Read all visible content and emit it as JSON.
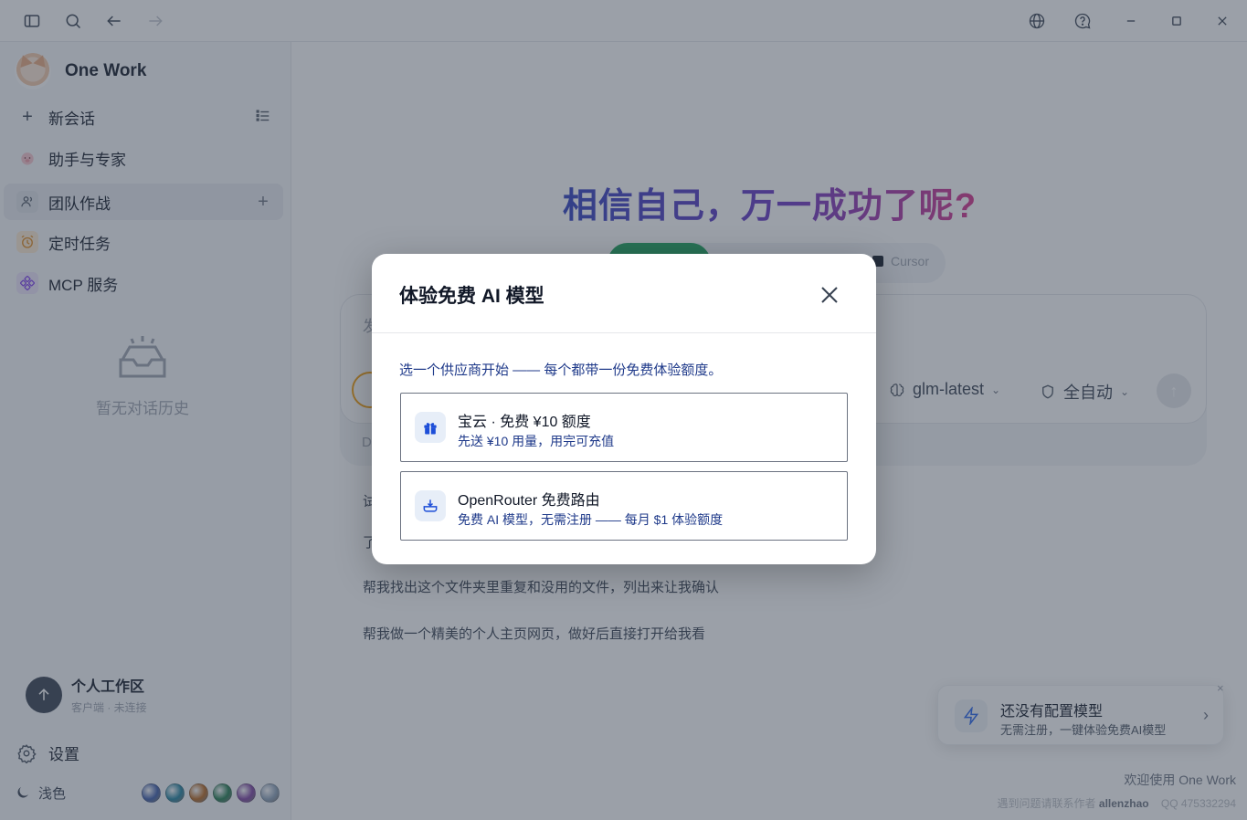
{
  "sidebar": {
    "brand": "One Work",
    "items": [
      {
        "label": "新会话"
      },
      {
        "label": "助手与专家"
      },
      {
        "label": "团队作战"
      },
      {
        "label": "定时任务"
      },
      {
        "label": "MCP 服务"
      }
    ],
    "empty_history": "暂无对话历史",
    "workspace": {
      "title": "个人工作区",
      "status": "客户端 · 未连接"
    },
    "settings_label": "设置",
    "theme_label": "浅色",
    "swatch_colors": [
      "#3b5ba9",
      "#1e7f9c",
      "#b5651d",
      "#1f7a4d",
      "#7b3fa0",
      "#8aa0b8"
    ]
  },
  "main": {
    "headline": "相信自己，万一成功了呢?",
    "pill_cursor": "Cursor",
    "composer_placeholder": "发",
    "model": "glm-latest",
    "mode": "全自动",
    "composer_bottom": "D",
    "suggestions": [
      "试",
      "了",
      "帮我找出这个文件夹里重复和没用的文件，列出来让我确认",
      "帮我做一个精美的个人主页网页，做好后直接打开给我看"
    ]
  },
  "toast": {
    "title": "还没有配置模型",
    "subtitle": "无需注册，一键体验免费AI模型"
  },
  "footer": {
    "welcome": "欢迎使用 One Work",
    "contact_prefix": "遇到问题请联系作者",
    "author": "allenzhao",
    "qq": "QQ 475332294"
  },
  "dialog": {
    "title": "体验免费 AI 模型",
    "description": "选一个供应商开始 —— 每个都带一份免费体验额度。",
    "options": [
      {
        "title": "宝云 · 免费 ¥10 额度",
        "subtitle": "先送 ¥10 用量，用完可充值",
        "icon": "gift-icon"
      },
      {
        "title": "OpenRouter 免费路由",
        "subtitle": "免费 AI 模型，无需注册 —— 每月 $1 体验额度",
        "icon": "router-icon"
      }
    ]
  }
}
